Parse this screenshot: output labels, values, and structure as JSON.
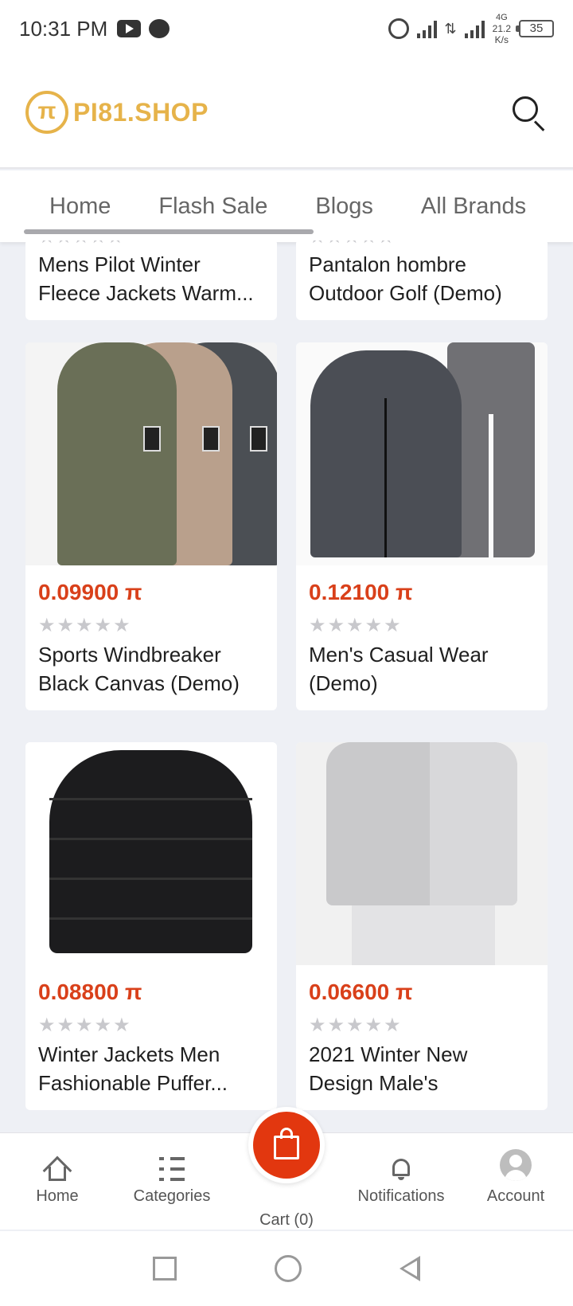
{
  "status_bar": {
    "time": "10:31 PM",
    "network": "4G",
    "speed_value": "21.2",
    "speed_unit": "K/s",
    "battery": "35"
  },
  "header": {
    "logo_text": "PI81.SHOP",
    "brand_color": "#e6b34a"
  },
  "tabs": [
    {
      "label": "Home",
      "active": true
    },
    {
      "label": "Flash Sale"
    },
    {
      "label": "Blogs"
    },
    {
      "label": "All Brands"
    }
  ],
  "products_partial": [
    {
      "name": "Mens Pilot Winter Fleece Jackets Warm..."
    },
    {
      "name": "Pantalon hombre Outdoor Golf (Demo)"
    }
  ],
  "products": [
    {
      "price": "0.09900 π",
      "rating": 0,
      "name": "Sports Windbreaker Black Canvas (Demo)",
      "image": "jackets-image"
    },
    {
      "price": "0.12100 π",
      "rating": 0,
      "name": "Men's Casual Wear (Demo)",
      "image": "tracksuit-image"
    },
    {
      "price": "0.08800 π",
      "rating": 0,
      "name": "Winter Jackets Men Fashionable Puffer...",
      "image": "puffer-jacket-image"
    },
    {
      "price": "0.06600 π",
      "rating": 0,
      "name": "2021 Winter New Design Male's",
      "image": "sweatshirt-image"
    }
  ],
  "price_color": "#d9401a",
  "bottom_nav": {
    "home": "Home",
    "categories": "Categories",
    "cart": "Cart (0)",
    "notifications": "Notifications",
    "account": "Account"
  },
  "accent_color": "#e2370f"
}
